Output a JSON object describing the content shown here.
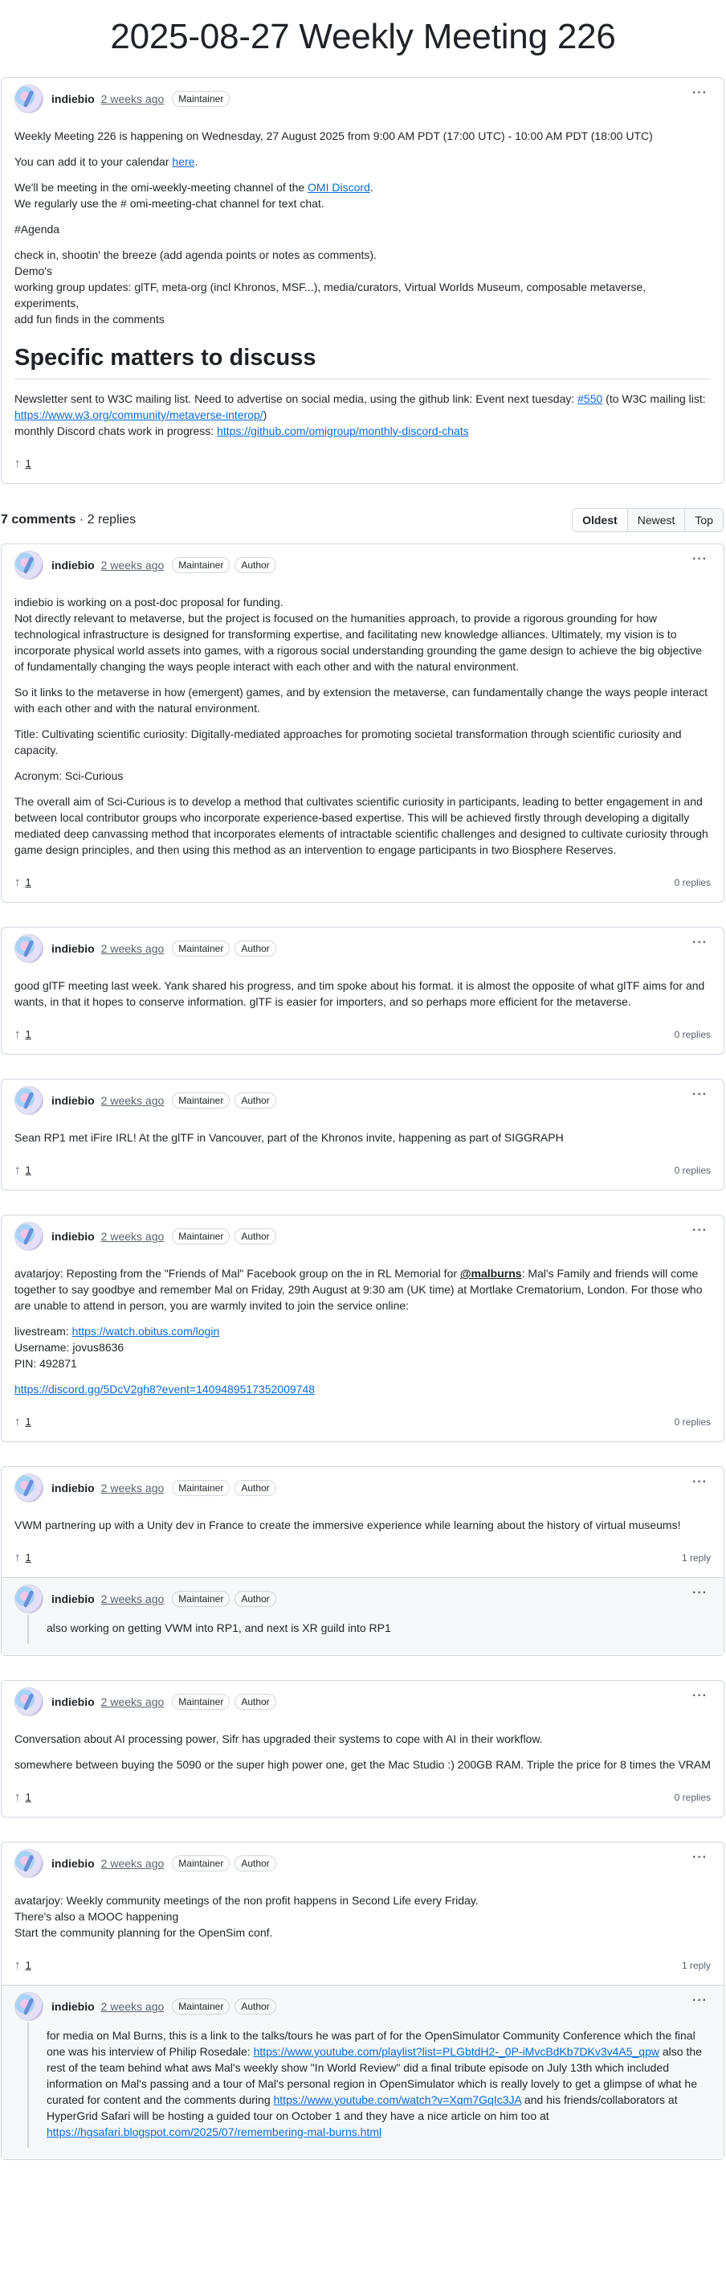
{
  "title": "2025-08-27 Weekly Meeting 226",
  "post": {
    "author": "indiebio",
    "time": "2 weeks ago",
    "badge_maintainer": "Maintainer",
    "line1": "Weekly Meeting 226 is happening on Wednesday, 27 August 2025 from 9:00 AM PDT (17:00 UTC) - 10:00 AM PDT (18:00 UTC)",
    "cal_prefix": "You can add it to your calendar ",
    "cal_link": "here",
    "cal_suffix": ".",
    "discord_prefix": "We'll be meeting in the omi-weekly-meeting channel of the ",
    "discord_link": "OMI Discord",
    "discord_suffix": ".",
    "chat_line": "We regularly use the # omi-meeting-chat channel for text chat.",
    "agenda": "#Agenda",
    "agenda_1": "check in, shootin' the breeze (add agenda points or notes as comments).",
    "agenda_2": "Demo's",
    "agenda_3": "working group updates: glTF, meta-org (incl Khronos, MSF...), media/curators, Virtual Worlds Museum, composable metaverse, experiments,",
    "agenda_4": "add fun finds in the comments",
    "heading": "Specific matters to discuss",
    "news_prefix": "Newsletter sent to W3C mailing list. Need to advertise on social media, using the github link: Event next tuesday: ",
    "news_link1": "#550",
    "news_mid": " (to W3C mailing list: ",
    "news_link2": "https://www.w3.org/community/metaverse-interop/",
    "news_suffix": ")",
    "monthly_prefix": "monthly Discord chats work in progress: ",
    "monthly_link": "https://github.com/omigroup/monthly-discord-chats",
    "votes": "1"
  },
  "summary": {
    "comments": "7 comments",
    "sep": " · ",
    "replies": "2 replies"
  },
  "sort": {
    "oldest": "Oldest",
    "newest": "Newest",
    "top": "Top"
  },
  "common": {
    "author": "indiebio",
    "time": "2 weeks ago",
    "maintainer": "Maintainer",
    "author_badge": "Author",
    "zero_replies": "0 replies",
    "one_reply": "1 reply",
    "votes": "1"
  },
  "c1": {
    "p1": "indiebio is working on a post-doc proposal for funding.",
    "p1b": "Not directly relevant to metaverse, but the project is focused on the humanities approach, to provide a rigorous grounding for how technological infrastructure is designed for transforming expertise, and facilitating new knowledge alliances. Ultimately, my vision is to incorporate physical world assets into games, with a rigorous social understanding grounding the game design to achieve the big objective of fundamentally changing the ways people interact with each other and with the natural environment.",
    "p2": "So it links to the metaverse in how (emergent) games, and by extension the metaverse, can fundamentally change the ways people interact with each other and with the natural environment.",
    "p3": "Title: Cultivating scientific curiosity: Digitally-mediated approaches for promoting societal transformation through scientific curiosity and capacity.",
    "p4": "Acronym: Sci-Curious",
    "p5": "The overall aim of Sci-Curious is to develop a method that cultivates scientific curiosity in participants, leading to better engagement in and between local contributor groups who incorporate experience-based expertise. This will be achieved firstly through developing a digitally mediated deep canvassing method that incorporates elements of intractable scientific challenges and designed to cultivate curiosity through game design principles, and then using this method as an intervention to engage participants in two Biosphere Reserves."
  },
  "c2": {
    "p1": "good glTF meeting last week. Yank shared his progress, and tim spoke about his format. it is almost the opposite of what glTF aims for and wants, in that it hopes to conserve information. glTF is easier for importers, and so perhaps more efficient for the metaverse."
  },
  "c3": {
    "p1": "Sean RP1 met iFire IRL! At the glTF in Vancouver, part of the Khronos invite, happening as part of SIGGRAPH"
  },
  "c4": {
    "p1_prefix": "avatarjoy: Reposting from the \"Friends of Mal\" Facebook group on the in RL Memorial for ",
    "p1_mention": "@malburns",
    "p1_suffix": ": Mal's Family and friends will come together to say goodbye and remember Mal on Friday, 29th August at 9:30 am (UK time) at Mortlake Crematorium, London. For those who are unable to attend in person, you are warmly invited to join the service online:",
    "live_prefix": "livestream: ",
    "live_link": "https://watch.obitus.com/login",
    "user": "Username: jovus8636",
    "pin": "PIN: 492871",
    "discord_link": "https://discord.gg/5DcV2gh8?event=1409489517352009748"
  },
  "c5": {
    "p1": "VWM partnering up with a Unity dev in France to create the immersive experience while learning about the history of virtual museums!",
    "reply": "also working on getting VWM into RP1, and next is XR guild into RP1"
  },
  "c6": {
    "p1": "Conversation about AI processing power, Sifr has upgraded their systems to cope with AI in their workflow.",
    "p2": "somewhere between buying the 5090 or the super high power one, get the Mac Studio :) 200GB RAM. Triple the price for 8 times the VRAM"
  },
  "c7": {
    "l1": "avatarjoy: Weekly community meetings of the non profit happens in Second Life every Friday.",
    "l2": "There's also a MOOC happening",
    "l3": "Start the community planning for the OpenSim conf.",
    "r_prefix": "for media on Mal Burns, this is a link to the talks/tours he was part of for the OpenSimulator Community Conference which the final one was his interview of Philip Rosedale: ",
    "r_link1": "https://www.youtube.com/playlist?list=PLGbtdH2-_0P-iMvcBdKb7DKv3v4A5_qpw",
    "r_mid": " also the rest of the team behind what aws Mal's weekly show \"In World Review\" did a final tribute episode on July 13th which included information on Mal's passing and a tour of Mal's personal region in OpenSimulator which is really lovely to get a glimpse of what he curated for content and the comments during ",
    "r_link2": "https://www.youtube.com/watch?v=Xqm7GqIc3JA",
    "r_mid2": " and his friends/collaborators at HyperGrid Safari will be hosting a guided tour on October 1 and they have a nice article on him too at ",
    "r_link3": "https://hgsafari.blogspot.com/2025/07/remembering-mal-burns.html"
  }
}
